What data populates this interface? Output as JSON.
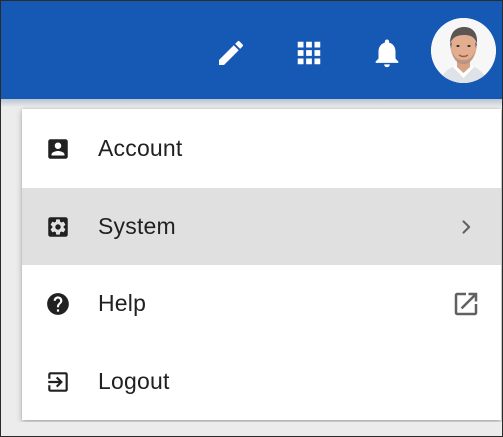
{
  "topbar": {
    "background": "#1559b5",
    "icons": {
      "edit": "pencil-icon",
      "apps": "apps-grid-icon",
      "notifications": "bell-icon",
      "avatar": "user-avatar"
    }
  },
  "menu": {
    "items": [
      {
        "label": "Account",
        "icon": "account-box-icon",
        "trailing": ""
      },
      {
        "label": "System",
        "icon": "system-settings-icon",
        "trailing": "chevron-right-icon"
      },
      {
        "label": "Help",
        "icon": "help-circle-icon",
        "trailing": "open-in-new-icon"
      },
      {
        "label": "Logout",
        "icon": "logout-icon",
        "trailing": ""
      }
    ],
    "hovered_item": "System",
    "hover_color": "#e0e0e0"
  }
}
